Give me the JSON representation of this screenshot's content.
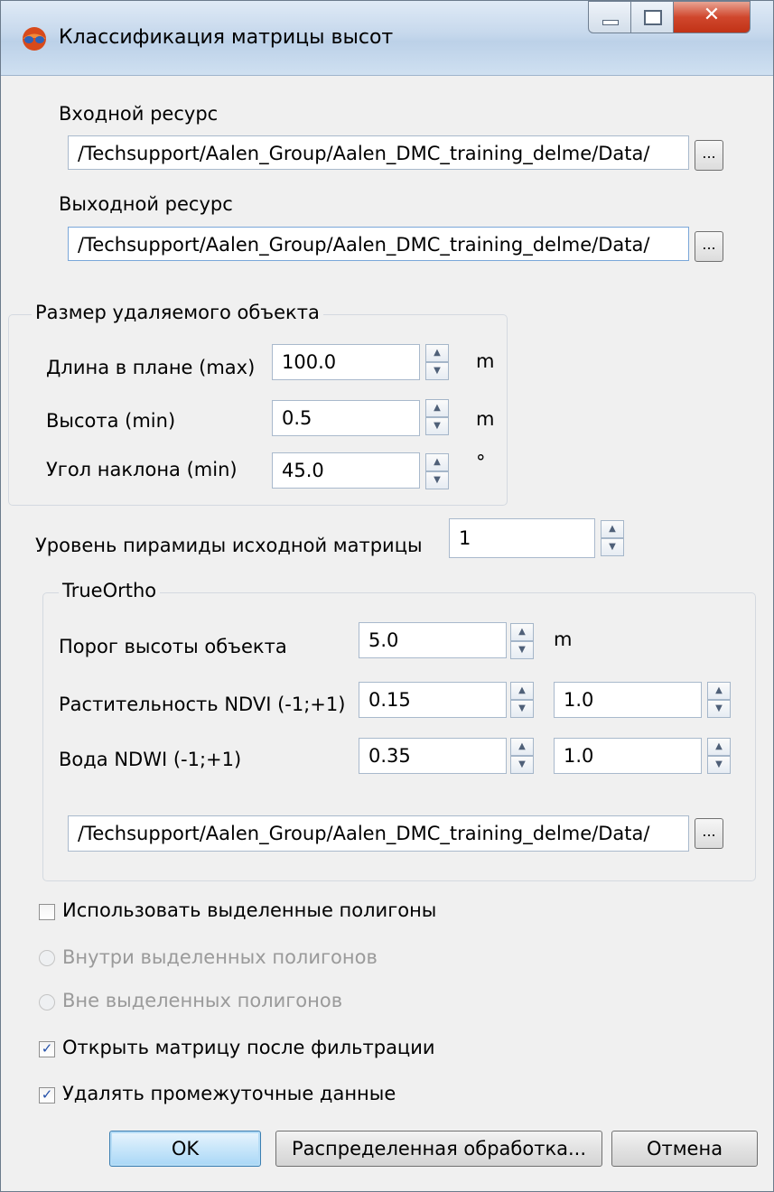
{
  "window": {
    "title": "Классификация матрицы высот",
    "minimize_glyph": "—",
    "maximize_glyph": "▢",
    "close_glyph": "✕"
  },
  "input_resource": {
    "label": "Входной ресурс",
    "value": "/Techsupport/Aalen_Group/Aalen_DMC_training_delme/Data/",
    "browse_label": "..."
  },
  "output_resource": {
    "label": "Выходной ресурс",
    "value": "/Techsupport/Aalen_Group/Aalen_DMC_training_delme/Data/",
    "browse_label": "..."
  },
  "object_size": {
    "title": "Размер удаляемого объекта",
    "length_label": "Длина в плане (max)",
    "length_value": "100.0",
    "length_unit": "m",
    "height_label": "Высота (min)",
    "height_value": "0.5",
    "height_unit": "m",
    "slope_label": "Угол наклона (min)",
    "slope_value": "45.0",
    "slope_unit": "°"
  },
  "pyramid": {
    "label": "Уровень пирамиды исходной матрицы",
    "value": "1"
  },
  "true_ortho": {
    "title": "TrueOrtho",
    "threshold_label": "Порог высоты объекта",
    "threshold_value": "5.0",
    "threshold_unit": "m",
    "ndvi_label": "Растительность NDVI (-1;+1)",
    "ndvi_min": "0.15",
    "ndvi_max": "1.0",
    "ndwi_label": "Вода NDWI (-1;+1)",
    "ndwi_min": "0.35",
    "ndwi_max": "1.0",
    "path_value": "/Techsupport/Aalen_Group/Aalen_DMC_training_delme/Data/",
    "browse_label": "..."
  },
  "options": {
    "use_polygons_label": "Использовать выделенные полигоны",
    "use_polygons_checked": false,
    "inside_label": "Внутри выделенных полигонов",
    "outside_label": "Вне выделенных полигонов",
    "open_after_label": "Открыть матрицу после фильтрации",
    "open_after_checked": true,
    "delete_temp_label": "Удалять промежуточные данные",
    "delete_temp_checked": true,
    "check_glyph": "✓"
  },
  "buttons": {
    "ok": "OK",
    "distributed": "Распределенная обработка...",
    "cancel": "Отмена"
  },
  "spin_glyphs": {
    "up": "▲",
    "down": "▼"
  }
}
